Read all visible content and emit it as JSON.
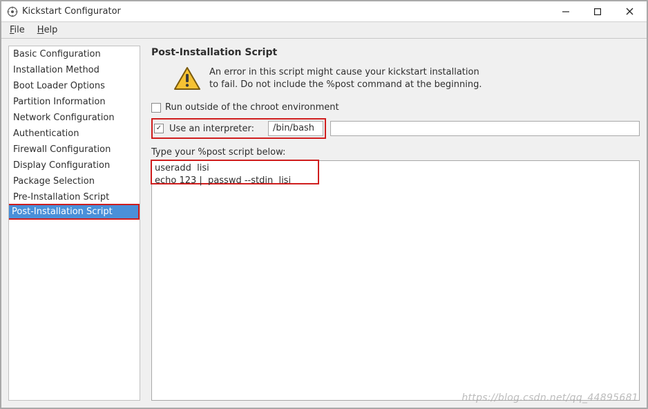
{
  "window": {
    "title": "Kickstart Configurator"
  },
  "menubar": {
    "file": "File",
    "help": "Help"
  },
  "sidebar": {
    "items": [
      {
        "label": "Basic Configuration"
      },
      {
        "label": "Installation Method"
      },
      {
        "label": "Boot Loader Options"
      },
      {
        "label": "Partition Information"
      },
      {
        "label": "Network Configuration"
      },
      {
        "label": "Authentication"
      },
      {
        "label": "Firewall Configuration"
      },
      {
        "label": "Display Configuration"
      },
      {
        "label": "Package Selection"
      },
      {
        "label": "Pre-Installation Script"
      },
      {
        "label": "Post-Installation Script"
      }
    ],
    "selected_index": 10
  },
  "main": {
    "heading": "Post-Installation Script",
    "warning_text": "An error in this script might cause your kickstart installation\nto fail. Do not include the %post command at the beginning.",
    "chroot_checkbox": {
      "label": "Run outside of the chroot environment",
      "checked": false
    },
    "interpreter_checkbox": {
      "label": "Use an interpreter:",
      "checked": true
    },
    "interpreter_value": "/bin/bash",
    "textarea_label": "Type your %post script below:",
    "script_body": "useradd  lisi\necho 123 |  passwd --stdin  lisi"
  },
  "watermark": "https://blog.csdn.net/qq_44895681"
}
